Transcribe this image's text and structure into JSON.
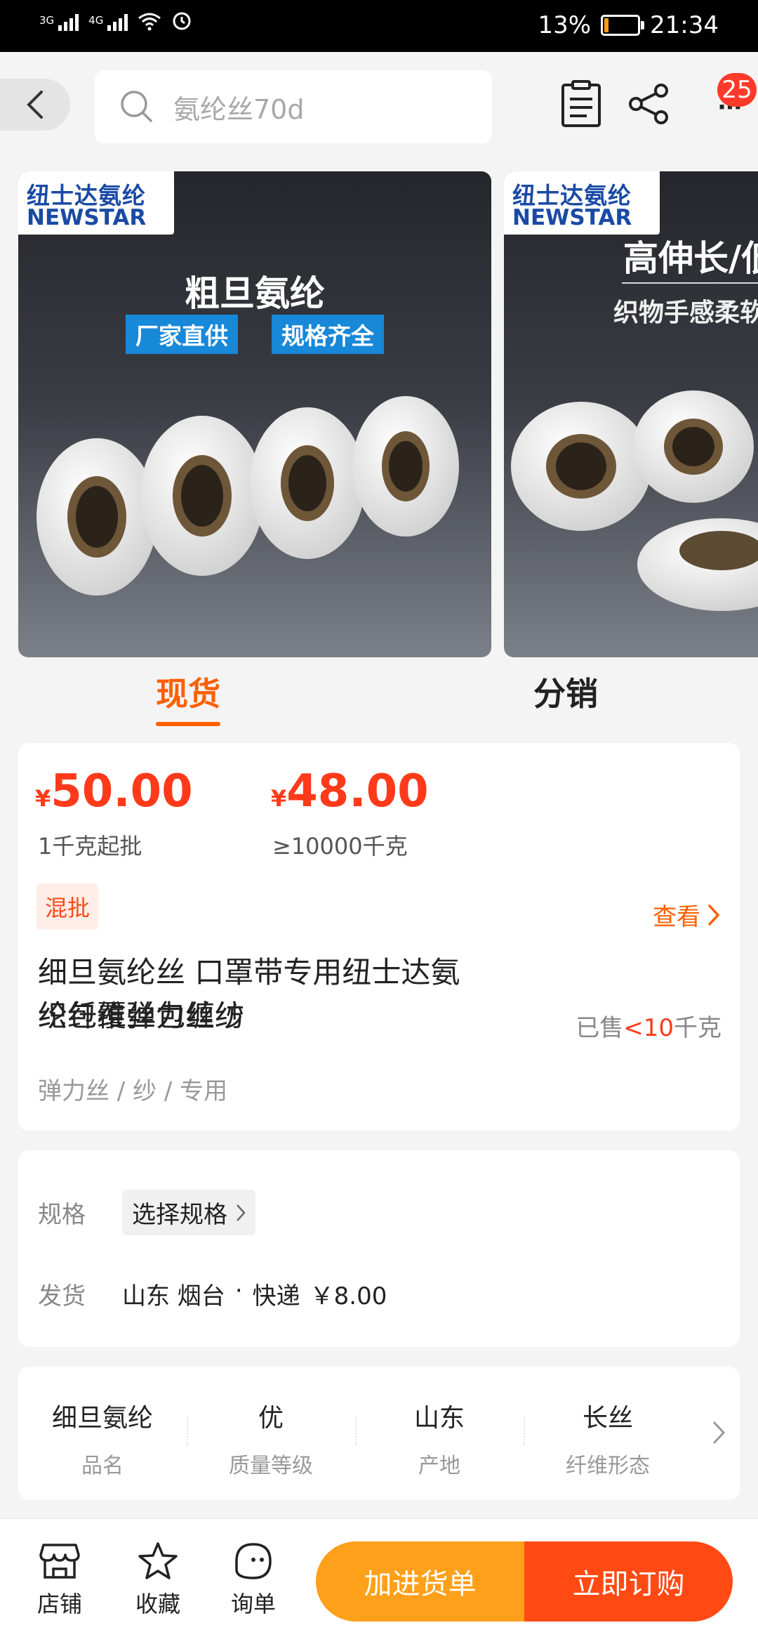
{
  "status_bar": {
    "net1": "3G",
    "net2": "4G",
    "battery_percent": "13%",
    "time": "21:34"
  },
  "header": {
    "search_placeholder": "氨纶丝70d",
    "message_count": "25"
  },
  "gallery": {
    "slides": [
      {
        "logo_cn": "纽士达氨纶",
        "logo_en": "NEWSTAR",
        "headline": "粗旦氨纶",
        "tags": [
          "厂家直供",
          "规格齐全"
        ]
      },
      {
        "logo_cn": "纽士达氨纶",
        "logo_en": "NEWSTAR",
        "headline": "高伸长/低",
        "subline": "织物手感柔软"
      }
    ]
  },
  "tabs": [
    {
      "label": "现货",
      "active": true
    },
    {
      "label": "分销",
      "active": false
    }
  ],
  "pricing": {
    "currency": "¥",
    "tiers": [
      {
        "price": "50.00",
        "note": "1千克起批"
      },
      {
        "price": "48.00",
        "note": "≥10000千克"
      }
    ],
    "mix_badge": "混批",
    "view_label": "查看"
  },
  "product": {
    "title_line1": "细旦氨纶丝 口罩带专用纽士达氨纶纤维弹力丝纺",
    "title_line2": "织包覆丝包缠纱",
    "sold_prefix": "已售",
    "sold_value": "<10",
    "sold_unit": "千克",
    "categories": "弹力丝 / 纱 / 专用"
  },
  "specs": {
    "spec_label": "规格",
    "spec_button": "选择规格",
    "ship_label": "发货",
    "ship_origin": "山东 烟台",
    "ship_sep": "·",
    "ship_method": "快递",
    "ship_fee": "￥8.00"
  },
  "attributes": [
    {
      "value": "细旦氨纶",
      "key": "品名"
    },
    {
      "value": "优",
      "key": "质量等级"
    },
    {
      "value": "山东",
      "key": "产地"
    },
    {
      "value": "长丝",
      "key": "纤维形态"
    }
  ],
  "bottom_bar": {
    "store": "店铺",
    "favorite": "收藏",
    "inquiry": "询单",
    "add_to_list": "加进货单",
    "buy_now": "立即订购"
  },
  "colors": {
    "accent": "#ff5f00",
    "price_red": "#ff3a1a",
    "add_button": "#ffa01a",
    "buy_button": "#ff4a14",
    "logo_blue": "#1a4aa5",
    "tag_blue": "#1888d8"
  }
}
